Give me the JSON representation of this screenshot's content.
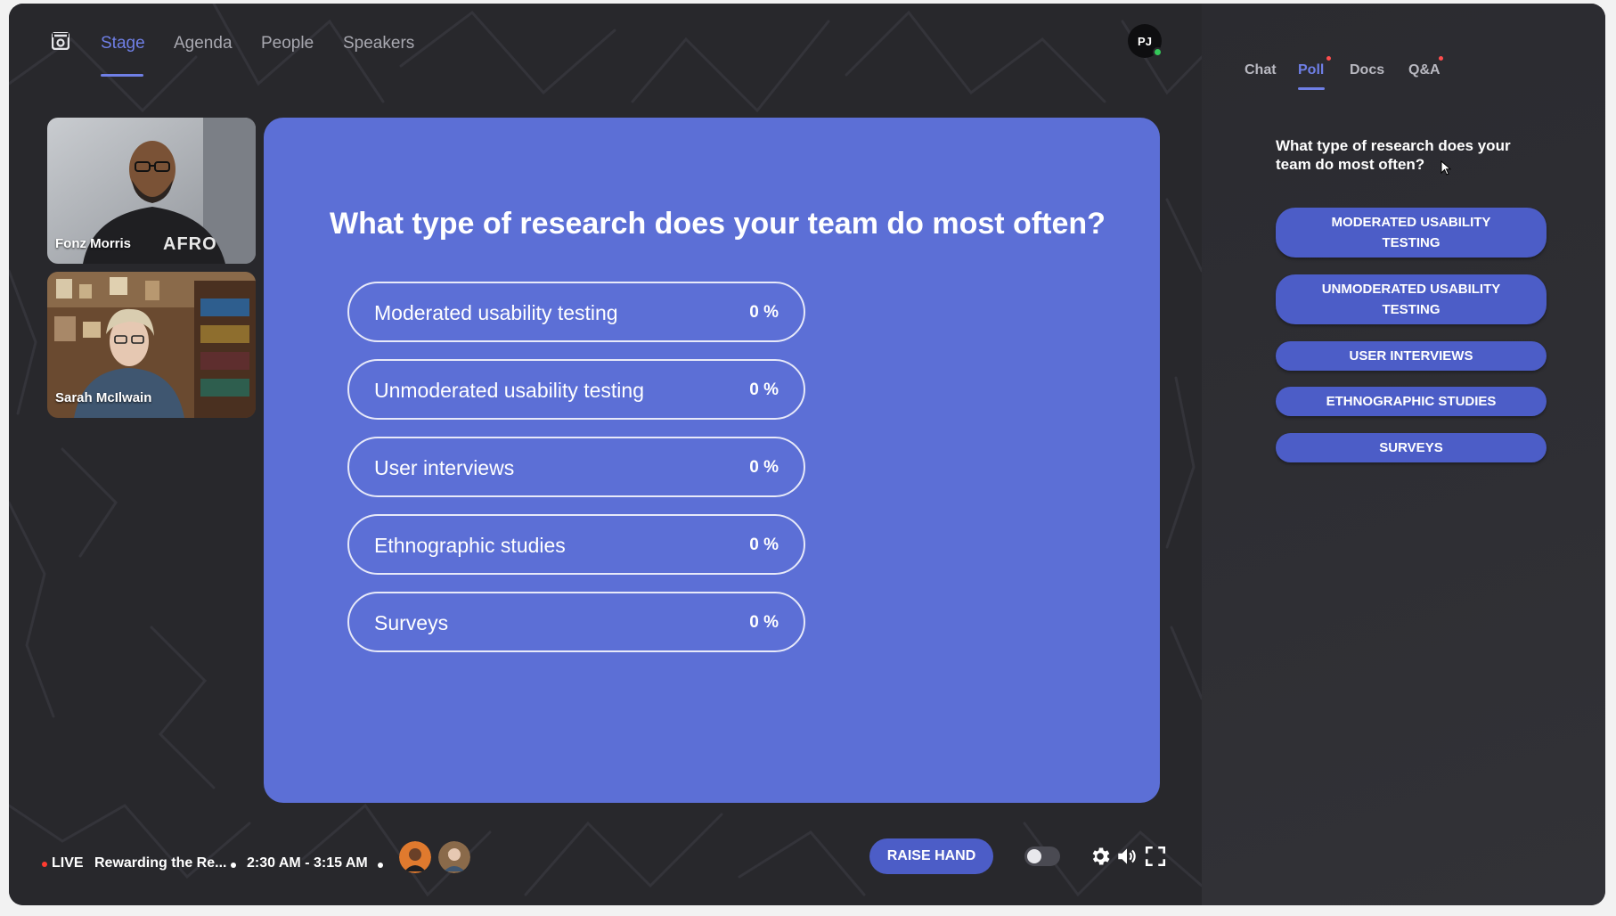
{
  "nav": {
    "tabs": [
      {
        "label": "Stage"
      },
      {
        "label": "Agenda"
      },
      {
        "label": "People"
      },
      {
        "label": "Speakers"
      }
    ],
    "user_initials": "PJ"
  },
  "videos": [
    {
      "name": "Fonz Morris",
      "shirt_text": "AFRO"
    },
    {
      "name": "Sarah McIlwain"
    }
  ],
  "slide": {
    "question": "What type of research does your team do most often?",
    "options": [
      {
        "label": "Moderated usability testing",
        "percent": "0 %",
        "percent_value": 0
      },
      {
        "label": "Unmoderated usability testing",
        "percent": "0 %",
        "percent_value": 0
      },
      {
        "label": "User interviews",
        "percent": "0 %",
        "percent_value": 0
      },
      {
        "label": "Ethnographic studies",
        "percent": "0 %",
        "percent_value": 0
      },
      {
        "label": "Surveys",
        "percent": "0 %",
        "percent_value": 0
      }
    ]
  },
  "bottom_bar": {
    "live_label": "LIVE",
    "session_title": "Rewarding the Re...",
    "time_range": "2:30 AM - 3:15 AM",
    "raise_hand_label": "RAISE HAND"
  },
  "side_panel": {
    "tabs": [
      {
        "label": "Chat"
      },
      {
        "label": "Poll"
      },
      {
        "label": "Docs"
      },
      {
        "label": "Q&A"
      }
    ],
    "question": "What type of research does your team do most often?",
    "options": [
      {
        "label": "MODERATED USABILITY TESTING"
      },
      {
        "label": "UNMODERATED USABILITY TESTING"
      },
      {
        "label": "USER INTERVIEWS"
      },
      {
        "label": "ETHNOGRAPHIC STUDIES"
      },
      {
        "label": "SURVEYS"
      }
    ]
  },
  "colors": {
    "accent": "#6f7fe6",
    "slide_bg": "#5c6fd6",
    "button_bg": "#4c5dc7",
    "live_red": "#ff3b30",
    "online_green": "#34c759"
  },
  "icons": [
    "logo-icon",
    "settings-icon",
    "volume-icon",
    "fullscreen-icon",
    "toggle-switch"
  ]
}
